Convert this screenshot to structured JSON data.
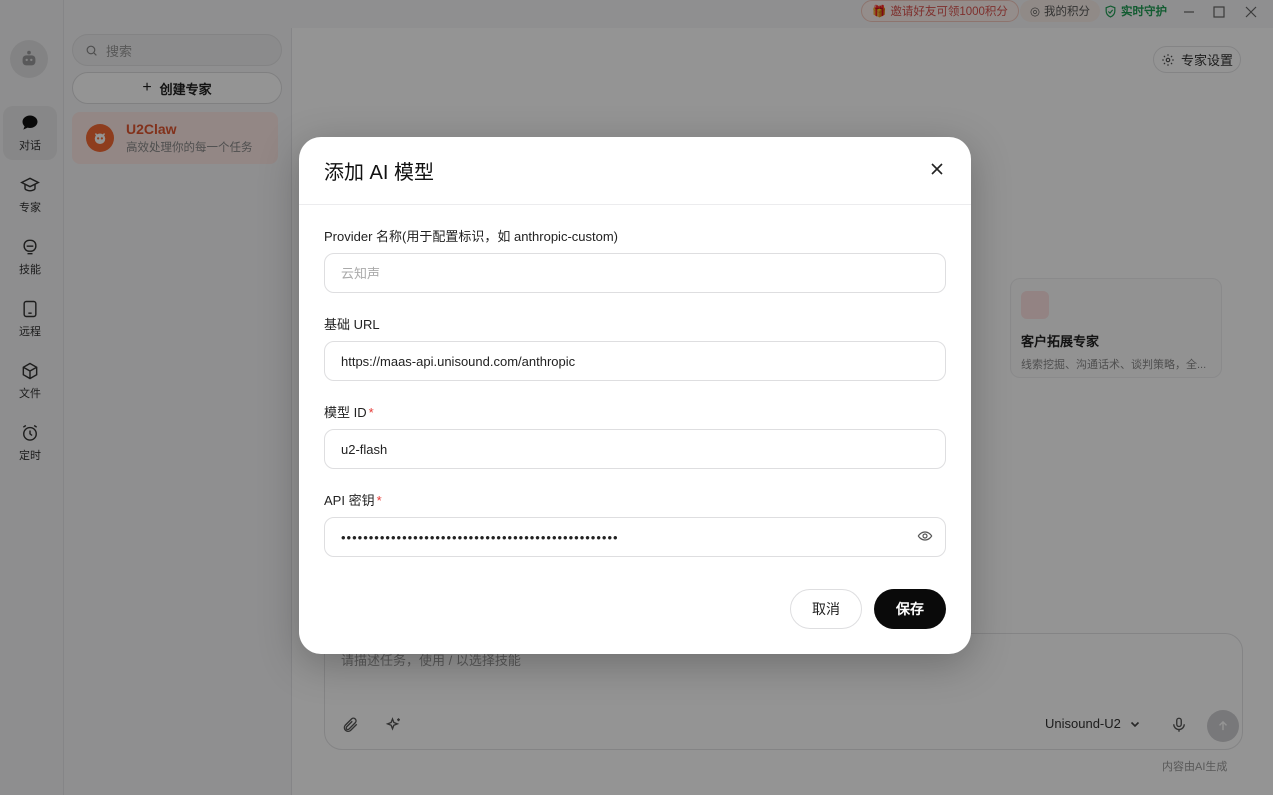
{
  "topbar": {
    "invite_label": "邀请好友可领1000积分",
    "points_label": "我的积分",
    "guard_label": "实时守护"
  },
  "rail": {
    "items": [
      {
        "label": "对话"
      },
      {
        "label": "专家"
      },
      {
        "label": "技能"
      },
      {
        "label": "远程"
      },
      {
        "label": "文件"
      },
      {
        "label": "定时"
      }
    ]
  },
  "sidebar": {
    "search_placeholder": "搜索",
    "create_label": "创建专家",
    "experts": [
      {
        "name": "U2Claw",
        "desc": "高效处理你的每一个任务"
      }
    ]
  },
  "main": {
    "settings_label": "专家设置",
    "cards": [
      {
        "title": "客户拓展专家",
        "desc": "线索挖掘、沟通话术、谈判策略，全..."
      }
    ],
    "input_placeholder": "请描述任务，使用 / 以选择技能",
    "model_name": "Unisound-U2",
    "ai_note": "内容由AI生成"
  },
  "modal": {
    "title": "添加 AI 模型",
    "provider_label": "Provider 名称(用于配置标识，如 anthropic-custom)",
    "provider_placeholder": "云知声",
    "provider_value": "",
    "url_label": "基础 URL",
    "url_value": "https://maas-api.unisound.com/anthropic",
    "model_id_label": "模型 ID",
    "model_id_value": "u2-flash",
    "api_key_label": "API 密钥",
    "api_key_value": "••••••••••••••••••••••••••••••••••••••••••••••••••",
    "required_mark": "*",
    "cancel_label": "取消",
    "save_label": "保存"
  },
  "colors": {
    "accent": "#e0552f",
    "guard": "#1f9d55",
    "required": "#e53935",
    "primary_button": "#0a0a0a"
  }
}
